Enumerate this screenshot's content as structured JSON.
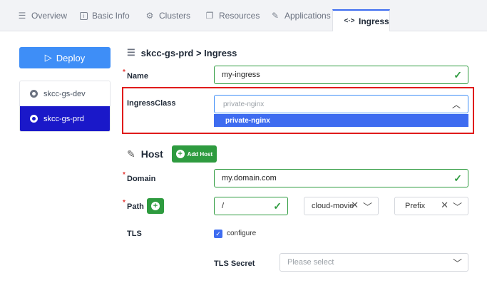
{
  "tabs": [
    {
      "label": "Overview",
      "icon": "list-icon"
    },
    {
      "label": "Basic Info",
      "icon": "info-icon"
    },
    {
      "label": "Clusters",
      "icon": "cluster-icon"
    },
    {
      "label": "Resources",
      "icon": "copy-icon"
    },
    {
      "label": "Applications",
      "icon": "apps-icon"
    },
    {
      "label": "Ingress",
      "icon": "code-icon"
    }
  ],
  "sidebar": {
    "deploy_label": "Deploy",
    "clusters": [
      {
        "label": "skcc-gs-dev",
        "active": false
      },
      {
        "label": "skcc-gs-prd",
        "active": true
      }
    ]
  },
  "main": {
    "breadcrumb": "skcc-gs-prd > Ingress",
    "name_label": "Name",
    "name_value": "my-ingress",
    "ingressclass_label": "IngressClass",
    "ingressclass_placeholder": "private-nginx",
    "ingressclass_option": "private-nginx",
    "host_title": "Host",
    "add_host_label": "Add Host",
    "domain_label": "Domain",
    "domain_value": "my.domain.com",
    "path_label": "Path",
    "path_value": "/",
    "service_value": "cloud-movie",
    "pathtype_value": "Prefix",
    "tls_label": "TLS",
    "tls_configure_label": "configure",
    "tls_checked": true,
    "tls_secret_label": "TLS Secret",
    "tls_secret_placeholder": "Please select"
  },
  "colors": {
    "accent": "#3e8ef7",
    "active_cluster": "#1a18c9",
    "success": "#2e9b3f",
    "highlight_border": "#e01b1b",
    "dropdown_selected": "#3e6cf0"
  }
}
